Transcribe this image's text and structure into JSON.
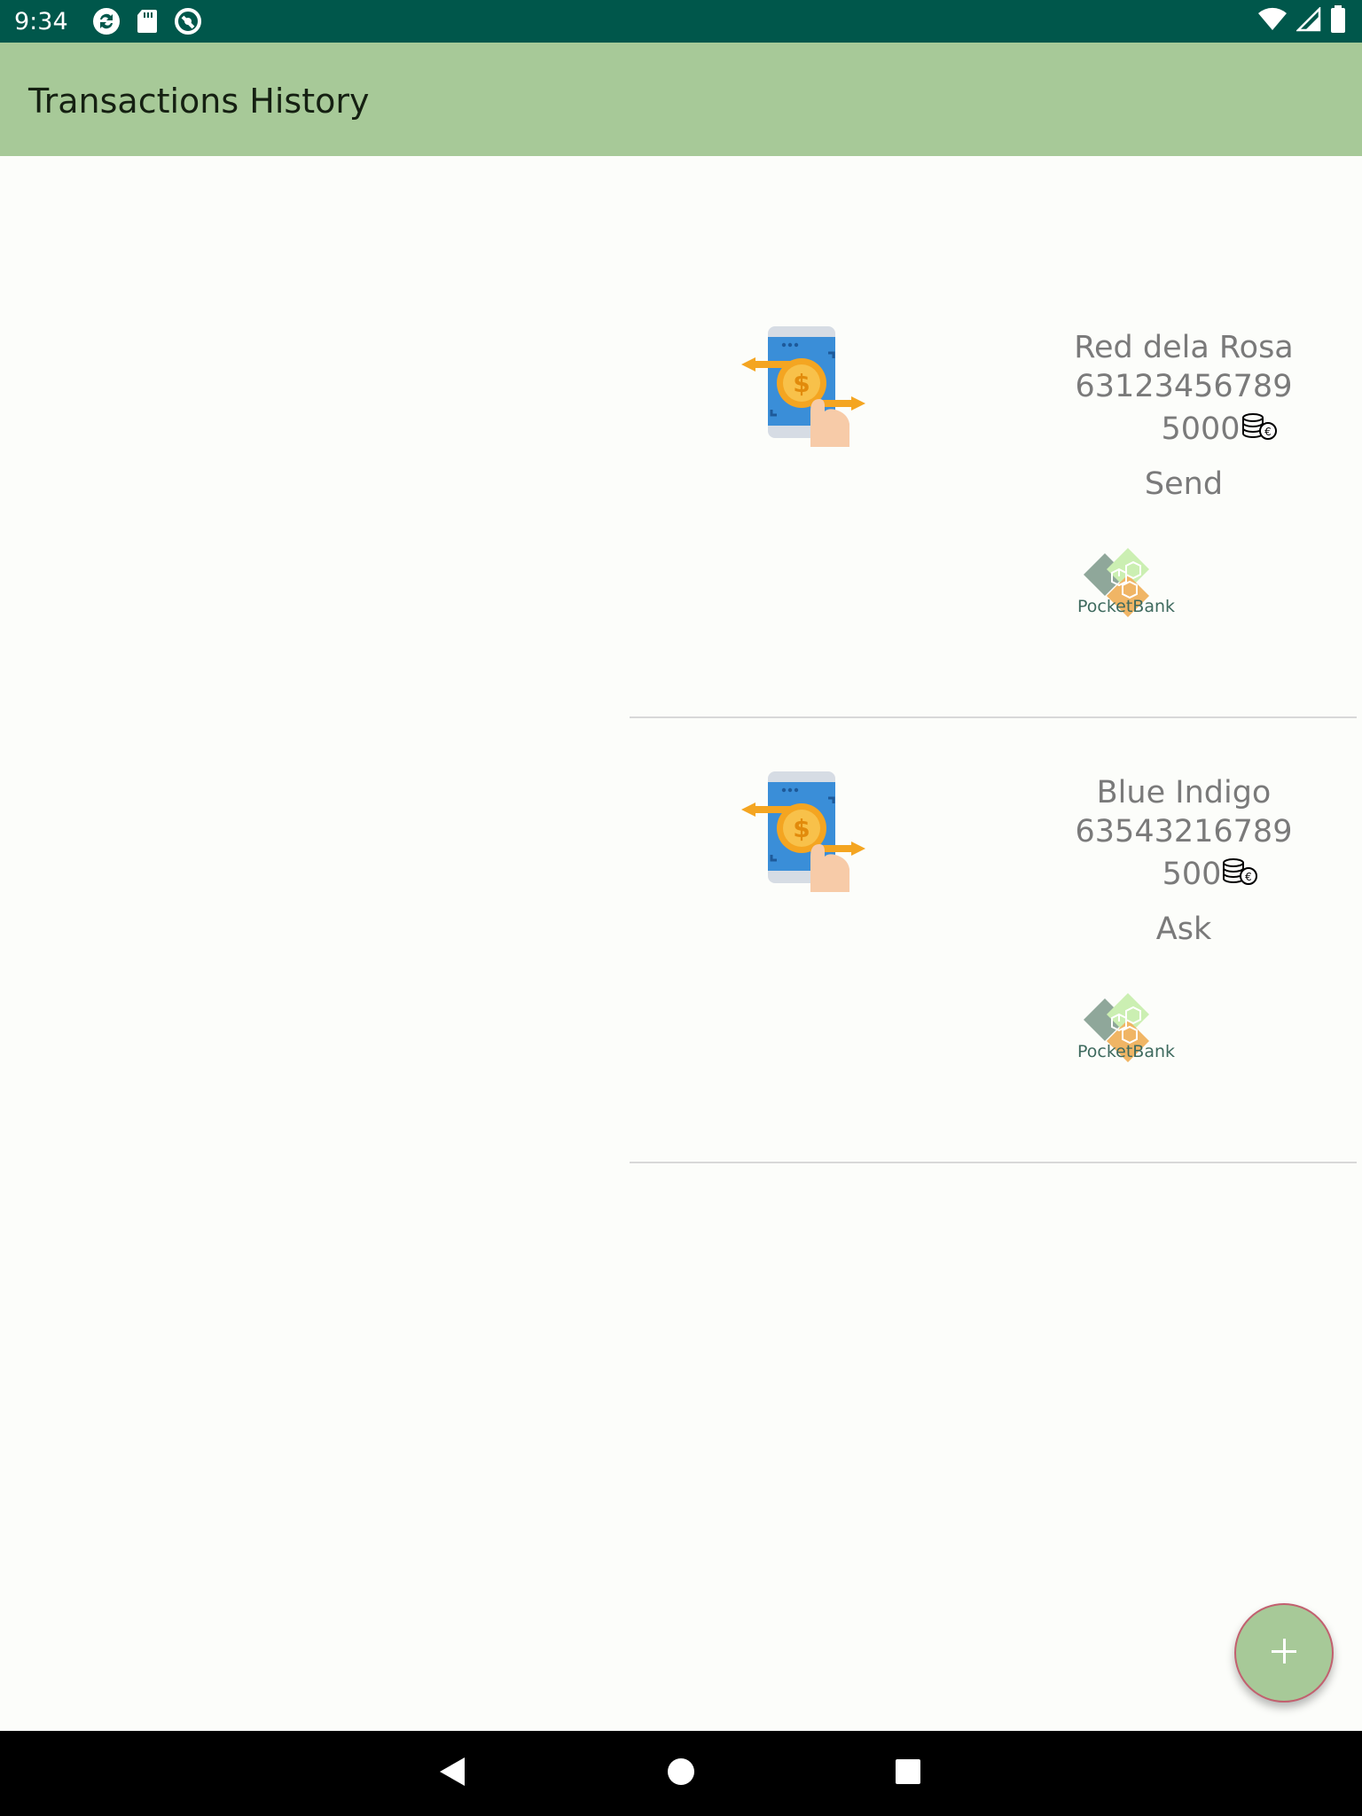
{
  "status_bar": {
    "time": "9:34",
    "left_icons": [
      "sync-icon",
      "sd-card-icon",
      "accessibility-icon"
    ],
    "right_icons": [
      "wifi-icon",
      "cell-signal-icon",
      "battery-icon"
    ]
  },
  "app_bar": {
    "title": "Transactions History",
    "color": "#A7C998"
  },
  "transactions": [
    {
      "name": "Red dela Rosa",
      "phone": "63123456789",
      "amount": "5000",
      "type": "Send",
      "logo_text": "PocketBank"
    },
    {
      "name": "Blue Indigo",
      "phone": "63543216789",
      "amount": "500",
      "type": "Ask",
      "logo_text": "PocketBank"
    }
  ],
  "fab": {
    "icon": "plus-icon"
  },
  "nav_bar": {
    "buttons": [
      "back-icon",
      "home-icon",
      "recents-icon"
    ]
  },
  "colors": {
    "status_bar": "#00574B",
    "accent": "#A7C998",
    "text_secondary": "#7A7A7A",
    "fab_border": "#C2606F"
  }
}
